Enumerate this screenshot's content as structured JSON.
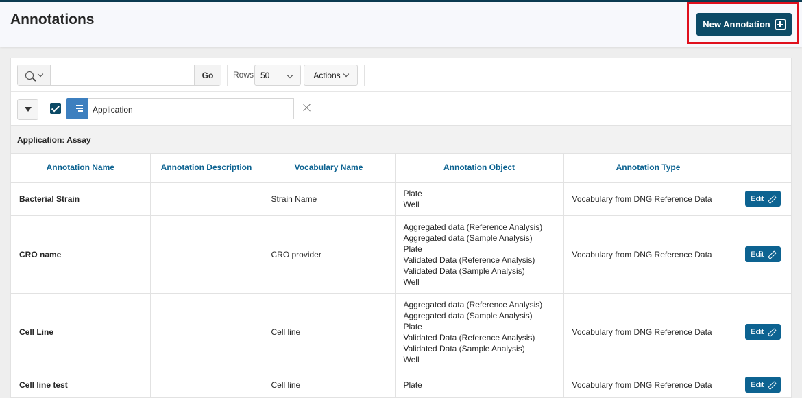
{
  "header": {
    "title": "Annotations",
    "new_button_label": "New Annotation"
  },
  "toolbar": {
    "search_value": "",
    "go_label": "Go",
    "rows_label": "Rows",
    "rows_value": "50",
    "actions_label": "Actions"
  },
  "filter": {
    "checked": true,
    "label": "Application"
  },
  "group": {
    "label": "Application: Assay"
  },
  "table": {
    "columns": [
      "Annotation Name",
      "Annotation Description",
      "Vocabulary Name",
      "Annotation Object",
      "Annotation Type",
      ""
    ],
    "edit_label": "Edit",
    "rows": [
      {
        "name": "Bacterial Strain",
        "description": "",
        "vocabulary": "Strain Name",
        "objects": [
          "Plate",
          "Well"
        ],
        "type": "Vocabulary from DNG Reference Data"
      },
      {
        "name": "CRO name",
        "description": "",
        "vocabulary": "CRO provider",
        "objects": [
          "Aggregated data (Reference Analysis)",
          "Aggregated data (Sample Analysis)",
          "Plate",
          "Validated Data (Reference Analysis)",
          "Validated Data (Sample Analysis)",
          "Well"
        ],
        "type": "Vocabulary from DNG Reference Data"
      },
      {
        "name": "Cell Line",
        "description": "",
        "vocabulary": "Cell line",
        "objects": [
          "Aggregated data (Reference Analysis)",
          "Aggregated data (Sample Analysis)",
          "Plate",
          "Validated Data (Reference Analysis)",
          "Validated Data (Sample Analysis)",
          "Well"
        ],
        "type": "Vocabulary from DNG Reference Data"
      },
      {
        "name": "Cell line test",
        "description": "",
        "vocabulary": "Cell line",
        "objects": [
          "Plate"
        ],
        "type": "Vocabulary from DNG Reference Data"
      }
    ]
  },
  "colors": {
    "header_dark": "#0c4a66",
    "link_blue": "#0d6391",
    "highlight_red": "#e0101d",
    "filter_icon_blue": "#3d7fbf"
  },
  "icons": [
    "search-icon",
    "chevron-down-icon",
    "plus-square-icon",
    "triangle-down-icon",
    "checkbox-checked-icon",
    "filter-lines-icon",
    "close-icon",
    "pencil-icon"
  ]
}
